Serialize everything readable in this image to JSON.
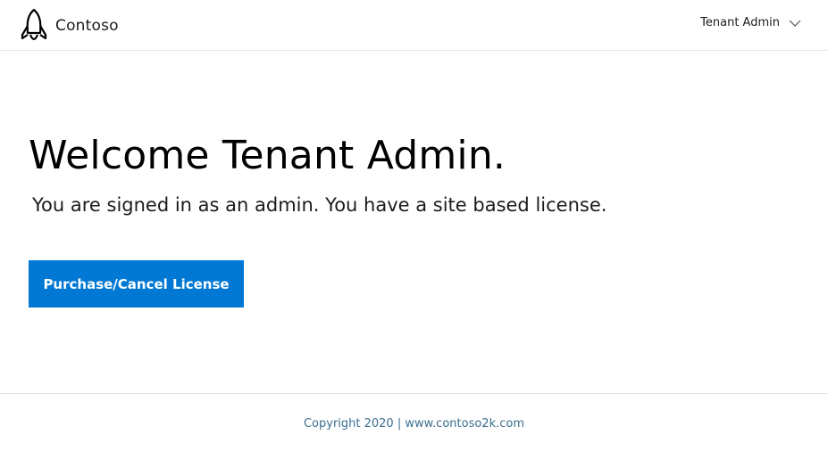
{
  "header": {
    "brand_name": "Contoso",
    "user_name": "Tenant Admin",
    "logo_icon": "rocket-icon",
    "menu_icon": "chevron-down-icon"
  },
  "main": {
    "heading": "Welcome Tenant Admin.",
    "subtitle": "You are signed in as an admin. You have a site based license.",
    "button_label": "Purchase/Cancel License"
  },
  "footer": {
    "copyright": "Copyright 2020 | www.contoso2k.com"
  },
  "colors": {
    "accent": "#0078d4",
    "footer_text": "#3b6e8f",
    "divider": "#e5e5e5"
  }
}
